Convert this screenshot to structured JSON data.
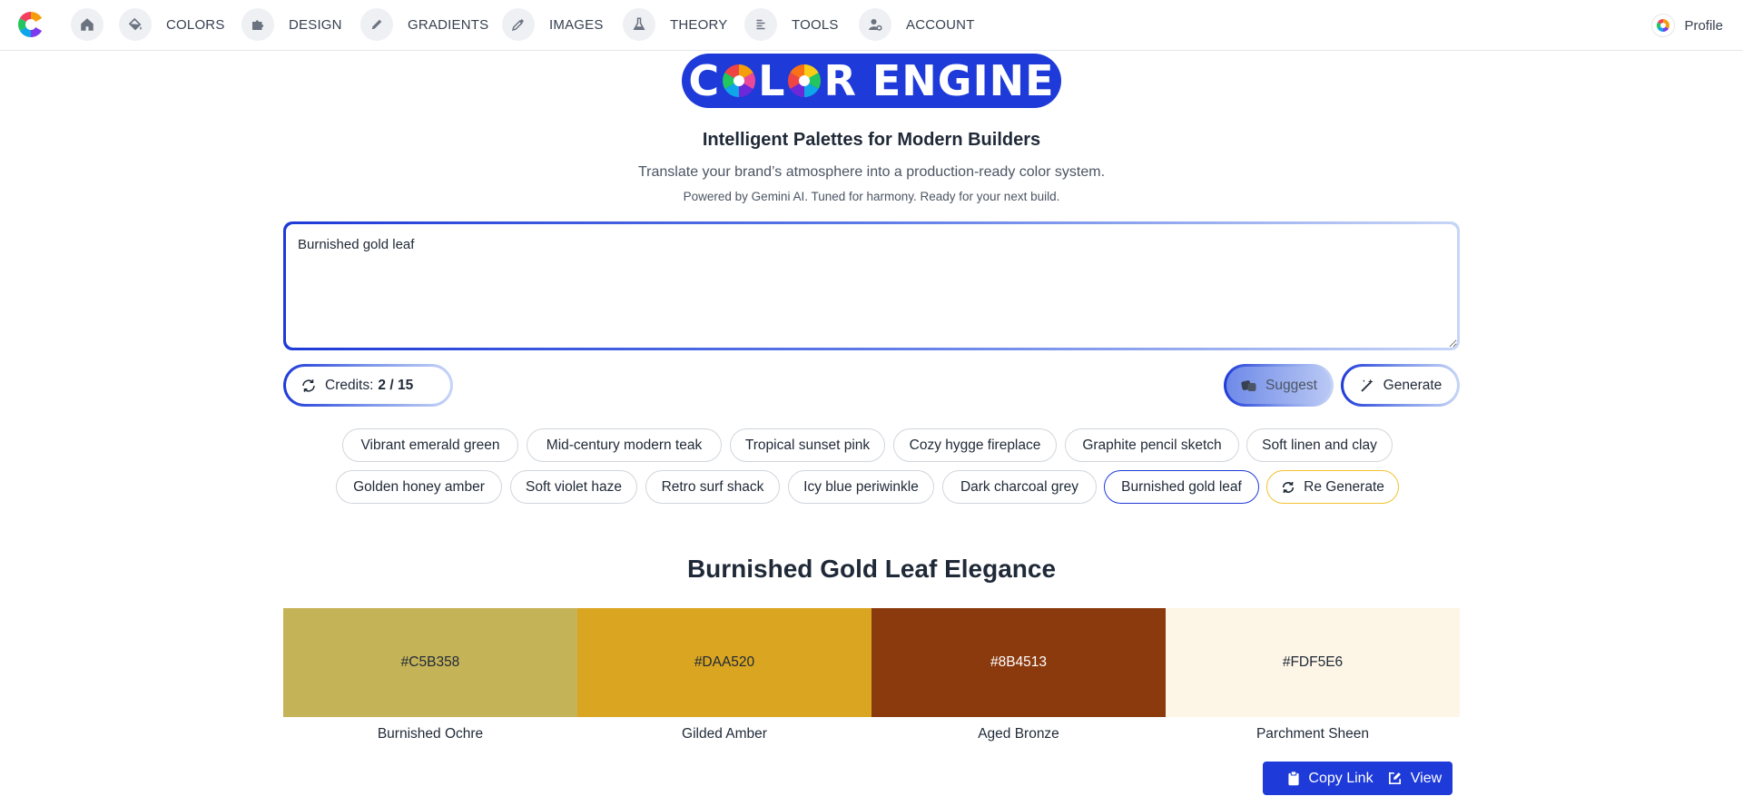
{
  "nav": {
    "items": [
      {
        "label": "COLORS",
        "icon": "paint-bucket-icon"
      },
      {
        "label": "DESIGN",
        "icon": "puzzle-icon"
      },
      {
        "label": "GRADIENTS",
        "icon": "pencil-icon"
      },
      {
        "label": "IMAGES",
        "icon": "eyedropper-icon"
      },
      {
        "label": "THEORY",
        "icon": "flask-icon"
      },
      {
        "label": "TOOLS",
        "icon": "align-left-icon"
      },
      {
        "label": "ACCOUNT",
        "icon": "user-gear-icon"
      }
    ],
    "profile_label": "Profile"
  },
  "brand": {
    "left": "C",
    "mid": "L",
    "right": "R ENGINE",
    "bg_color": "#1e3ad8"
  },
  "hero": {
    "tagline": "Intelligent Palettes for Modern Builders",
    "subtitle": "Translate your brand’s atmosphere into a production-ready color system.",
    "powered_by": "Powered by Gemini AI. Tuned for harmony. Ready for your next build."
  },
  "prompt": {
    "value": "Burnished gold leaf"
  },
  "controls": {
    "credits_label": "Credits:",
    "credits_value": "2 / 15",
    "suggest_label": "Suggest",
    "generate_label": "Generate"
  },
  "chips": [
    [
      "Vibrant emerald green",
      "Mid-century modern teak",
      "Tropical sunset pink",
      "Cozy hygge fireplace",
      "Graphite pencil sketch",
      "Soft linen and clay"
    ],
    [
      "Golden honey amber",
      "Soft violet haze",
      "Retro surf shack",
      "Icy blue periwinkle",
      "Dark charcoal grey",
      "Burnished gold leaf",
      "Re Generate"
    ]
  ],
  "active_chip": "Burnished gold leaf",
  "result": {
    "title": "Burnished Gold Leaf Elegance",
    "swatches": [
      {
        "hex": "#C5B358",
        "name": "Burnished Ochre",
        "text_color": "#1f2937"
      },
      {
        "hex": "#DAA520",
        "name": "Gilded Amber",
        "text_color": "#1f2937"
      },
      {
        "hex": "#8B4513",
        "name": "Aged Bronze",
        "text_color": "#ffffff"
      },
      {
        "hex": "#FDF5E6",
        "name": "Parchment Sheen",
        "text_color": "#1f2937"
      }
    ],
    "copy_link_label": "Copy Link",
    "view_label": "View"
  }
}
